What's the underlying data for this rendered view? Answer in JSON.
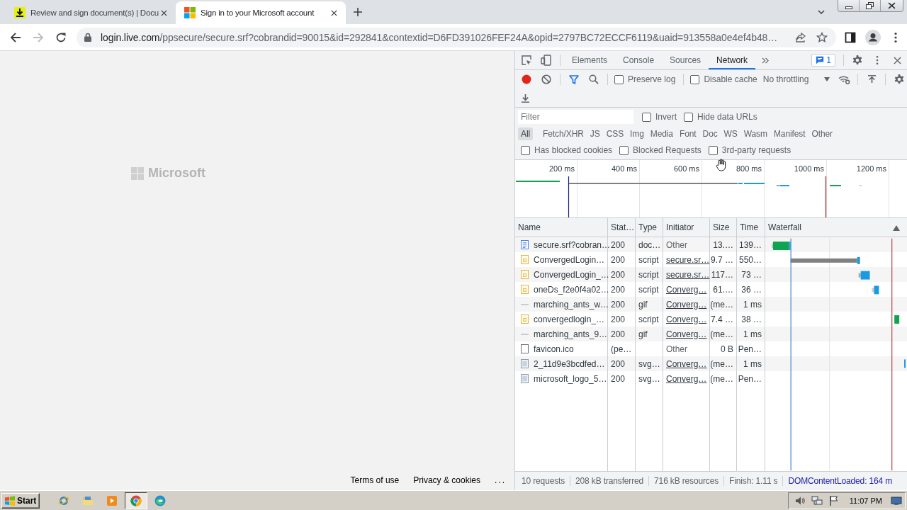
{
  "browser": {
    "tabs": [
      {
        "kind": "download",
        "title": "Review and sign document(s) | Docu",
        "selected": false
      },
      {
        "kind": "squares",
        "title": "Sign in to your Microsoft account",
        "selected": true
      }
    ],
    "navigation": {
      "back_disabled": false,
      "forward_disabled": true
    },
    "address": {
      "host": "login.live.com",
      "path": "/ppsecure/secure.srf?cobrandid=90015&id=292841&contextid=D6FD391026FEF24A&opid=2797BC72ECCF6119&uaid=913558a0e4ef4b48…"
    }
  },
  "page": {
    "logo": "Microsoft",
    "footer": [
      "Terms of use",
      "Privacy & cookies"
    ],
    "more": "..."
  },
  "devtools": {
    "tabs": [
      {
        "label": "Elements",
        "selected": false
      },
      {
        "label": "Console",
        "selected": false
      },
      {
        "label": "Sources",
        "selected": false
      },
      {
        "label": "Network",
        "selected": true
      }
    ],
    "issues": "1",
    "toolbar": {
      "recording": true,
      "options": [
        {
          "label": "Preserve log",
          "checked": false
        },
        {
          "label": "Disable cache",
          "checked": false
        }
      ],
      "throttling": "No throttling"
    },
    "filter": {
      "placeholder": "Filter",
      "options": [
        {
          "label": "Invert",
          "checked": false
        },
        {
          "label": "Hide data URLs",
          "checked": false
        }
      ]
    },
    "types": [
      {
        "label": "All",
        "selected": true
      },
      {
        "label": "Fetch/XHR",
        "selected": false
      },
      {
        "label": "JS",
        "selected": false
      },
      {
        "label": "CSS",
        "selected": false
      },
      {
        "label": "Img",
        "selected": false
      },
      {
        "label": "Media",
        "selected": false
      },
      {
        "label": "Font",
        "selected": false
      },
      {
        "label": "Doc",
        "selected": false
      },
      {
        "label": "WS",
        "selected": false
      },
      {
        "label": "Wasm",
        "selected": false
      },
      {
        "label": "Manifest",
        "selected": false
      },
      {
        "label": "Other",
        "selected": false
      }
    ],
    "request_filters": [
      {
        "label": "Has blocked cookies",
        "checked": false
      },
      {
        "label": "Blocked Requests",
        "checked": false
      },
      {
        "label": "3rd-party requests",
        "checked": false
      }
    ],
    "overview": {
      "ticks": [
        "200 ms",
        "400 ms",
        "600 ms",
        "800 ms",
        "1000 ms",
        "1200 ms"
      ]
    },
    "table": {
      "columns": [
        "Name",
        "Stat…",
        "Type",
        "Initiator",
        "Size",
        "Time",
        "Waterfall"
      ],
      "rows": [
        {
          "kind": "document",
          "name": "secure.srf?cobran…",
          "status": "200",
          "type": "doc…",
          "initiator": "Other",
          "initiator_link": false,
          "size": "13.…",
          "time": "139…"
        },
        {
          "kind": "script",
          "name": "ConvergedLogin…",
          "status": "200",
          "type": "script",
          "initiator": "secure.sr…",
          "initiator_link": true,
          "size": "9.7 …",
          "time": "550…"
        },
        {
          "kind": "script",
          "name": "ConvergedLogin_…",
          "status": "200",
          "type": "script",
          "initiator": "secure.sr…",
          "initiator_link": true,
          "size": "117…",
          "time": "73 …"
        },
        {
          "kind": "script",
          "name": "oneDs_f2e0f4a02…",
          "status": "200",
          "type": "script",
          "initiator": "Converg…",
          "initiator_link": true,
          "size": "61.…",
          "time": "36 …"
        },
        {
          "kind": "gif",
          "name": "marching_ants_w…",
          "status": "200",
          "type": "gif",
          "initiator": "Converg…",
          "initiator_link": true,
          "size": "(me…",
          "time": "1 ms"
        },
        {
          "kind": "script",
          "name": "convergedlogin_…",
          "status": "200",
          "type": "script",
          "initiator": "Converg…",
          "initiator_link": true,
          "size": "7.4 …",
          "time": "38 …"
        },
        {
          "kind": "gif",
          "name": "marching_ants_9…",
          "status": "200",
          "type": "gif",
          "initiator": "Converg…",
          "initiator_link": true,
          "size": "(me…",
          "time": "1 ms"
        },
        {
          "kind": "blank",
          "name": "favicon.ico",
          "status": "(pe…",
          "initiator": "Other",
          "initiator_link": false,
          "size": "0 B",
          "time": "Pen…"
        },
        {
          "kind": "image",
          "name": "2_11d9e3bcdfed…",
          "status": "200",
          "type": "svg…",
          "initiator": "Converg…",
          "initiator_link": true,
          "size": "(me…",
          "time": "1 ms"
        },
        {
          "kind": "image",
          "name": "microsoft_logo_5…",
          "status": "200",
          "type": "svg…",
          "initiator": "Converg…",
          "initiator_link": true,
          "size": "(me…",
          "time": "Pen…"
        }
      ]
    },
    "status_bar": [
      {
        "kind": "summary",
        "text": "10 requests"
      },
      {
        "kind": "summary",
        "text": "208 kB transferred"
      },
      {
        "kind": "summary",
        "text": "716 kB resources"
      },
      {
        "kind": "summary",
        "text": "Finish: 1.11 s"
      },
      {
        "kind": "event",
        "text": "DOMContentLoaded: 164 m"
      }
    ]
  },
  "taskbar": {
    "start": "Start",
    "apps": [
      {
        "kind": "ie",
        "selected": false
      },
      {
        "kind": "folder",
        "selected": false
      },
      {
        "kind": "media",
        "selected": false
      },
      {
        "kind": "chrome",
        "selected": true
      },
      {
        "kind": "edge",
        "selected": false
      }
    ],
    "clock": "11:07 PM"
  }
}
